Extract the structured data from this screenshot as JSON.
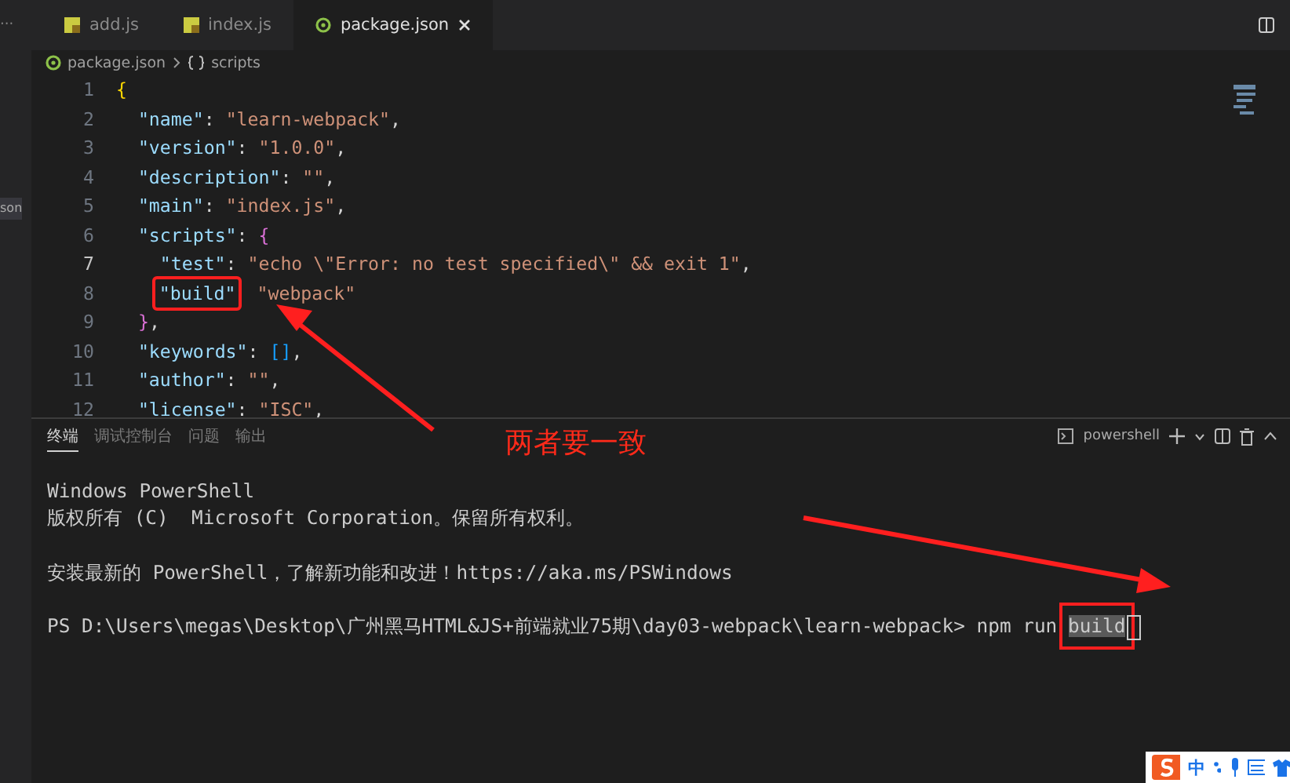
{
  "sidebar": {
    "overflow": "···",
    "item": {
      "label": "son",
      "selected": true
    }
  },
  "tabs": [
    {
      "label": "add.js",
      "kind": "js",
      "selected": false
    },
    {
      "label": "index.js",
      "kind": "js",
      "selected": false
    },
    {
      "label": "package.json",
      "kind": "json",
      "selected": true
    }
  ],
  "breadcrumb": [
    {
      "label": "package.json",
      "kind": "json"
    },
    {
      "label": "scripts",
      "kind": "object"
    }
  ],
  "code": [
    {
      "num": "1",
      "current": false,
      "tokens": [
        {
          "kind": "brace1",
          "text": "{"
        }
      ]
    },
    {
      "num": "2",
      "current": false,
      "tokens": [
        {
          "kind": "key",
          "text": "\"name\""
        },
        {
          "kind": "punct",
          "text": ":"
        },
        {
          "kind": "string",
          "text": "\"learn-webpack\""
        },
        {
          "kind": "punct",
          "text": ","
        }
      ]
    },
    {
      "num": "3",
      "current": false,
      "tokens": [
        {
          "kind": "key",
          "text": "\"version\""
        },
        {
          "kind": "punct",
          "text": ":"
        },
        {
          "kind": "string",
          "text": "\"1.0.0\""
        },
        {
          "kind": "punct",
          "text": ","
        }
      ]
    },
    {
      "num": "4",
      "current": false,
      "tokens": [
        {
          "kind": "key",
          "text": "\"description\""
        },
        {
          "kind": "punct",
          "text": ":"
        },
        {
          "kind": "string",
          "text": "\"\""
        },
        {
          "kind": "punct",
          "text": ","
        }
      ]
    },
    {
      "num": "5",
      "current": false,
      "tokens": [
        {
          "kind": "key",
          "text": "\"main\""
        },
        {
          "kind": "punct",
          "text": ":"
        },
        {
          "kind": "string",
          "text": "\"index.js\""
        },
        {
          "kind": "punct",
          "text": ","
        }
      ]
    },
    {
      "num": "6",
      "current": false,
      "tokens": [
        {
          "kind": "key",
          "text": "\"scripts\""
        },
        {
          "kind": "punct",
          "text": ":"
        },
        {
          "kind": "brace2",
          "text": "{"
        }
      ]
    },
    {
      "num": "7",
      "current": true,
      "tokens": [
        {
          "kind": "key",
          "text": "\"test\""
        },
        {
          "kind": "punct",
          "text": ":"
        },
        {
          "kind": "string",
          "text": "\"echo \\\"Error: no test specified\\\" && exit 1\""
        },
        {
          "kind": "punct",
          "text": ","
        }
      ]
    },
    {
      "num": "8",
      "current": false,
      "tokens": [
        {
          "kind": "key",
          "text": "\"build\"",
          "boxed": true
        },
        {
          "kind": "string",
          "text": "\"webpack\""
        }
      ]
    },
    {
      "num": "9",
      "current": false,
      "tokens": [
        {
          "kind": "brace2",
          "text": "}"
        },
        {
          "kind": "punct",
          "text": ","
        }
      ]
    },
    {
      "num": "10",
      "current": false,
      "tokens": [
        {
          "kind": "key",
          "text": "\"keywords\""
        },
        {
          "kind": "punct",
          "text": ":"
        },
        {
          "kind": "brace3",
          "text": "[]"
        },
        {
          "kind": "punct",
          "text": ","
        }
      ]
    },
    {
      "num": "11",
      "current": false,
      "tokens": [
        {
          "kind": "key",
          "text": "\"author\""
        },
        {
          "kind": "punct",
          "text": ":"
        },
        {
          "kind": "string",
          "text": "\"\""
        },
        {
          "kind": "punct",
          "text": ","
        }
      ]
    },
    {
      "num": "12",
      "current": false,
      "tokens": [
        {
          "kind": "key",
          "text": "\"license\""
        },
        {
          "kind": "punct",
          "text": ":"
        },
        {
          "kind": "string",
          "text": "\"ISC\""
        },
        {
          "kind": "punct",
          "text": ","
        }
      ]
    }
  ],
  "panel": {
    "tabs": [
      {
        "label": "终端",
        "selected": true
      },
      {
        "label": "调试控制台",
        "selected": false
      },
      {
        "label": "问题",
        "selected": false
      },
      {
        "label": "输出",
        "selected": false
      }
    ],
    "shell": "powershell"
  },
  "terminal": {
    "lines": [
      {
        "text": "Windows PowerShell",
        "blank_after": false
      },
      {
        "text": "版权所有 (C)  Microsoft Corporation。保留所有权利。",
        "blank_after": true
      },
      {
        "text": "安装最新的 PowerShell，了解新功能和改进！https://aka.ms/PSWindows",
        "blank_after": true
      }
    ],
    "prompt": "PS D:\\Users\\megas\\Desktop\\广州黑马HTML&JS+前端就业75期\\day03-webpack\\learn-webpack>",
    "command": "npm run",
    "selection": {
      "text": "build",
      "selected": true,
      "boxed": true
    }
  },
  "annotation": {
    "note": "两者要一致"
  },
  "ime": {
    "mode": "中"
  }
}
